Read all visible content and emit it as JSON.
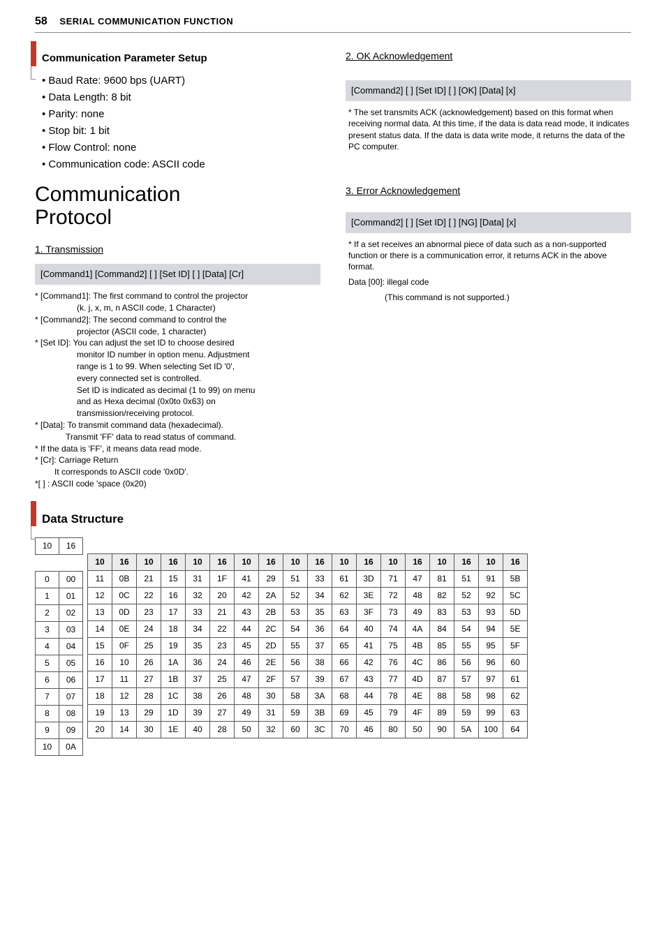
{
  "header": {
    "page": "58",
    "title": "SERIAL COMMUNICATION FUNCTION"
  },
  "left": {
    "sub1": "Communication Parameter Setup",
    "bullets": [
      "Baud Rate: 9600 bps (UART)",
      "Data Length: 8 bit",
      "Parity: none",
      "Stop bit: 1 bit",
      "Flow Control: none",
      "Communication code: ASCII code"
    ],
    "h1a": "Communication",
    "h1b": "Protocol",
    "trans_head": "1. Transmission",
    "trans_box": "[Command1] [Command2] [ ] [Set ID] [ ] [Data] [Cr]",
    "notes": [
      "* [Command1]: The first command to control the projector",
      "(k. j, x, m, n ASCII code, 1 Character)",
      "* [Command2]: The second command to control the",
      "projector (ASCII code, 1 character)",
      "* [Set ID]: You can adjust the set ID to choose desired",
      "monitor ID number in option menu. Adjustment",
      "range is 1 to 99. When selecting Set ID '0',",
      "every connected set is controlled.",
      "Set ID is indicated as decimal (1 to 99) on menu",
      "and as Hexa decimal (0x0to 0x63) on",
      "transmission/receiving protocol.",
      "* [Data]: To transmit command data (hexadecimal).",
      "Transmit 'FF' data to read status of command.",
      "* If the data is 'FF', it means data read mode.",
      "* [Cr]: Carriage Return",
      "It corresponds to ASCII code '0x0D'.",
      "*[ ] : ASCII code 'space (0x20)"
    ]
  },
  "right": {
    "ok_head": "2. OK Acknowledgement",
    "ok_box": "[Command2] [ ] [Set ID] [ ] [OK] [Data] [x]",
    "ok_note": "* The set transmits ACK (acknowledgement) based on this format when receiving normal data. At this time, if the data is data read mode, it indicates present status data. If the data is data write mode, it returns the data of the PC computer.",
    "err_head": "3. Error Acknowledgement",
    "err_box": "[Command2] [ ] [Set ID] [ ] [NG] [Data] [x]",
    "err_note1": "* If a set receives an abnormal piece of data such as a non-supported function or there is a communication error, it returns ACK in the above format.",
    "err_note2": "Data [00]: illegal code",
    "err_note3": "(This command is not supported.)"
  },
  "ds": {
    "title": "Data Structure",
    "small_head": [
      "10",
      "16"
    ],
    "small_rows": [
      [
        "0",
        "00"
      ],
      [
        "1",
        "01"
      ],
      [
        "2",
        "02"
      ],
      [
        "3",
        "03"
      ],
      [
        "4",
        "04"
      ],
      [
        "5",
        "05"
      ],
      [
        "6",
        "06"
      ],
      [
        "7",
        "07"
      ],
      [
        "8",
        "08"
      ],
      [
        "9",
        "09"
      ],
      [
        "10",
        "0A"
      ]
    ],
    "col_head": [
      "10",
      "16"
    ],
    "blocks": [
      [
        [
          "11",
          "0B"
        ],
        [
          "12",
          "0C"
        ],
        [
          "13",
          "0D"
        ],
        [
          "14",
          "0E"
        ],
        [
          "15",
          "0F"
        ],
        [
          "16",
          "10"
        ],
        [
          "17",
          "11"
        ],
        [
          "18",
          "12"
        ],
        [
          "19",
          "13"
        ],
        [
          "20",
          "14"
        ]
      ],
      [
        [
          "21",
          "15"
        ],
        [
          "22",
          "16"
        ],
        [
          "23",
          "17"
        ],
        [
          "24",
          "18"
        ],
        [
          "25",
          "19"
        ],
        [
          "26",
          "1A"
        ],
        [
          "27",
          "1B"
        ],
        [
          "28",
          "1C"
        ],
        [
          "29",
          "1D"
        ],
        [
          "30",
          "1E"
        ]
      ],
      [
        [
          "31",
          "1F"
        ],
        [
          "32",
          "20"
        ],
        [
          "33",
          "21"
        ],
        [
          "34",
          "22"
        ],
        [
          "35",
          "23"
        ],
        [
          "36",
          "24"
        ],
        [
          "37",
          "25"
        ],
        [
          "38",
          "26"
        ],
        [
          "39",
          "27"
        ],
        [
          "40",
          "28"
        ]
      ],
      [
        [
          "41",
          "29"
        ],
        [
          "42",
          "2A"
        ],
        [
          "43",
          "2B"
        ],
        [
          "44",
          "2C"
        ],
        [
          "45",
          "2D"
        ],
        [
          "46",
          "2E"
        ],
        [
          "47",
          "2F"
        ],
        [
          "48",
          "30"
        ],
        [
          "49",
          "31"
        ],
        [
          "50",
          "32"
        ]
      ],
      [
        [
          "51",
          "33"
        ],
        [
          "52",
          "34"
        ],
        [
          "53",
          "35"
        ],
        [
          "54",
          "36"
        ],
        [
          "55",
          "37"
        ],
        [
          "56",
          "38"
        ],
        [
          "57",
          "39"
        ],
        [
          "58",
          "3A"
        ],
        [
          "59",
          "3B"
        ],
        [
          "60",
          "3C"
        ]
      ],
      [
        [
          "61",
          "3D"
        ],
        [
          "62",
          "3E"
        ],
        [
          "63",
          "3F"
        ],
        [
          "64",
          "40"
        ],
        [
          "65",
          "41"
        ],
        [
          "66",
          "42"
        ],
        [
          "67",
          "43"
        ],
        [
          "68",
          "44"
        ],
        [
          "69",
          "45"
        ],
        [
          "70",
          "46"
        ]
      ],
      [
        [
          "71",
          "47"
        ],
        [
          "72",
          "48"
        ],
        [
          "73",
          "49"
        ],
        [
          "74",
          "4A"
        ],
        [
          "75",
          "4B"
        ],
        [
          "76",
          "4C"
        ],
        [
          "77",
          "4D"
        ],
        [
          "78",
          "4E"
        ],
        [
          "79",
          "4F"
        ],
        [
          "80",
          "50"
        ]
      ],
      [
        [
          "81",
          "51"
        ],
        [
          "82",
          "52"
        ],
        [
          "83",
          "53"
        ],
        [
          "84",
          "54"
        ],
        [
          "85",
          "55"
        ],
        [
          "86",
          "56"
        ],
        [
          "87",
          "57"
        ],
        [
          "88",
          "58"
        ],
        [
          "89",
          "59"
        ],
        [
          "90",
          "5A"
        ]
      ],
      [
        [
          "91",
          "5B"
        ],
        [
          "92",
          "5C"
        ],
        [
          "93",
          "5D"
        ],
        [
          "94",
          "5E"
        ],
        [
          "95",
          "5F"
        ],
        [
          "96",
          "60"
        ],
        [
          "97",
          "61"
        ],
        [
          "98",
          "62"
        ],
        [
          "99",
          "63"
        ],
        [
          "100",
          "64"
        ]
      ]
    ]
  }
}
